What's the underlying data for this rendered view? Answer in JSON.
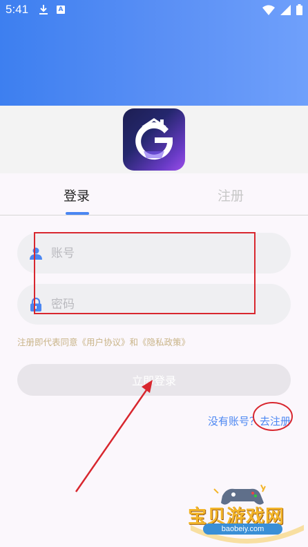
{
  "status_bar": {
    "time": "5:41",
    "left_icons": [
      "download-icon",
      "a-badge-icon"
    ],
    "right_icons": [
      "wifi-icon",
      "signal-icon",
      "battery-icon"
    ]
  },
  "app": {
    "logo_letter": "G",
    "logo_icon": "game-house-logo-icon"
  },
  "tabs": [
    {
      "label": "登录",
      "active": true
    },
    {
      "label": "注册",
      "active": false
    }
  ],
  "form": {
    "account": {
      "placeholder": "账号",
      "value": "",
      "icon": "user-icon"
    },
    "password": {
      "placeholder": "密码",
      "value": "",
      "icon": "lock-icon"
    },
    "agreement_text": "注册即代表同意《用户协议》和《隐私政策》",
    "login_button_label": "立即登录"
  },
  "register_prompt": {
    "question": "没有账号？",
    "link": "去注册"
  },
  "colors": {
    "accent": "#4a86f2",
    "annotation_red": "#d8262e",
    "agreement_text": "#c9b488"
  },
  "watermark": {
    "title": "宝贝游戏网",
    "url": "baobeiy.com"
  }
}
